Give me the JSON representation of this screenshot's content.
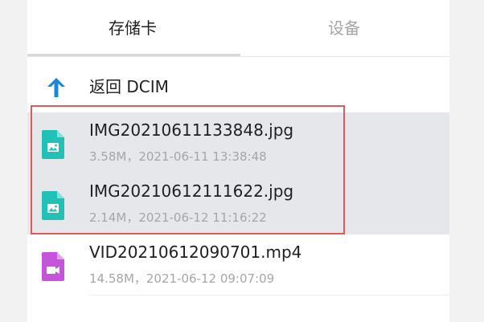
{
  "tabs": [
    {
      "label": "存储卡",
      "active": true
    },
    {
      "label": "设备",
      "active": false
    }
  ],
  "back": {
    "label": "返回 DCIM",
    "icon": "up-arrow-icon",
    "color": "#1a88d8"
  },
  "files": [
    {
      "name": "IMG20210611133848.jpg",
      "meta": "3.58M，2021-06-11 13:38:48",
      "type": "image",
      "icon": "image-file-icon",
      "selected": true
    },
    {
      "name": "IMG20210612111622.jpg",
      "meta": "2.14M，2021-06-12 11:16:22",
      "type": "image",
      "icon": "image-file-icon",
      "selected": true
    },
    {
      "name": "VID20210612090701.mp4",
      "meta": "14.58M，2021-06-12 09:07:09",
      "type": "video",
      "icon": "video-file-icon",
      "selected": false
    }
  ],
  "colors": {
    "image_icon": "#22c1b8",
    "video_icon": "#c454db",
    "highlight_border": "#e05a5a",
    "selection_bg": "#e6e7ea"
  }
}
